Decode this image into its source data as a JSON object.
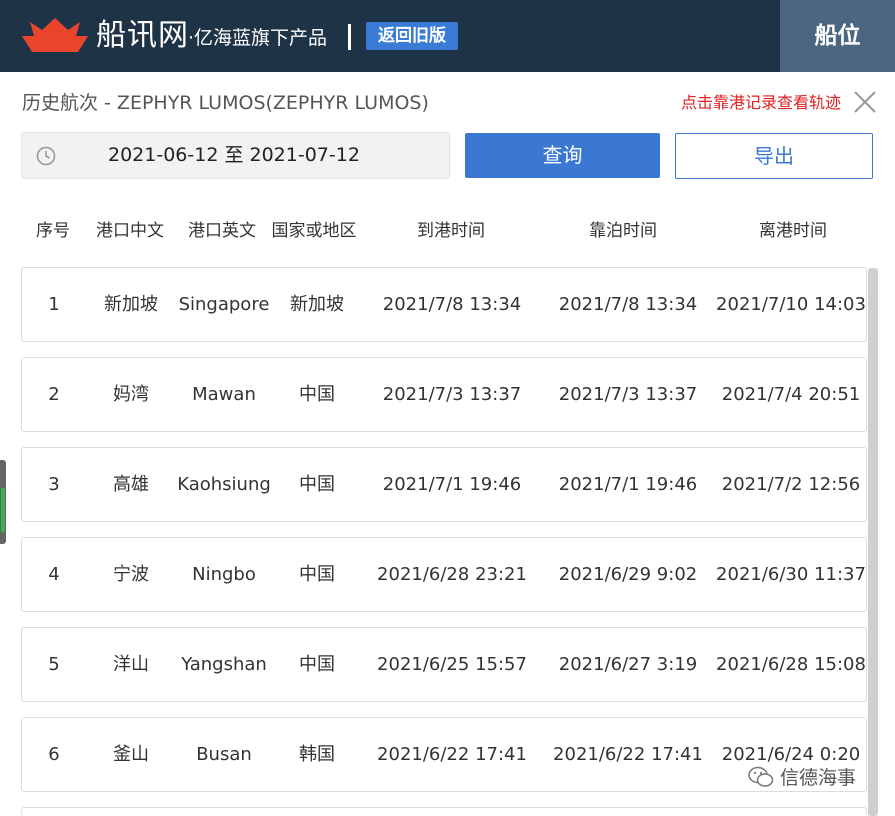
{
  "header": {
    "brand": "船讯网",
    "brand_sub": "·亿海蓝旗下产品",
    "old_version_label": "返回旧版",
    "berth_tab_label": "船位",
    "logo_icon": "boat-logo-icon"
  },
  "panel": {
    "title": "历史航次 - ZEPHYR LUMOS(ZEPHYR LUMOS)",
    "track_link": "点击靠港记录查看轨迹",
    "close_icon": "close-icon"
  },
  "filter": {
    "date_range": "2021-06-12 至 2021-07-12",
    "query_label": "查询",
    "export_label": "导出",
    "clock_icon": "clock-icon"
  },
  "table": {
    "headers": [
      "序号",
      "港口中文",
      "港口英文",
      "国家或地区",
      "到港时间",
      "靠泊时间",
      "离港时间"
    ],
    "rows": [
      {
        "no": "1",
        "port_cn": "新加坡",
        "port_en": "Singapore",
        "country": "新加坡",
        "arrive": "2021/7/8 13:34",
        "berth": "2021/7/8 13:34",
        "depart": "2021/7/10 14:03"
      },
      {
        "no": "2",
        "port_cn": "妈湾",
        "port_en": "Mawan",
        "country": "中国",
        "arrive": "2021/7/3 13:37",
        "berth": "2021/7/3 13:37",
        "depart": "2021/7/4 20:51"
      },
      {
        "no": "3",
        "port_cn": "高雄",
        "port_en": "Kaohsiung",
        "country": "中国",
        "arrive": "2021/7/1 19:46",
        "berth": "2021/7/1 19:46",
        "depart": "2021/7/2 12:56"
      },
      {
        "no": "4",
        "port_cn": "宁波",
        "port_en": "Ningbo",
        "country": "中国",
        "arrive": "2021/6/28 23:21",
        "berth": "2021/6/29 9:02",
        "depart": "2021/6/30 11:37"
      },
      {
        "no": "5",
        "port_cn": "洋山",
        "port_en": "Yangshan",
        "country": "中国",
        "arrive": "2021/6/25 15:57",
        "berth": "2021/6/27 3:19",
        "depart": "2021/6/28 15:08"
      },
      {
        "no": "6",
        "port_cn": "釜山",
        "port_en": "Busan",
        "country": "韩国",
        "arrive": "2021/6/22 17:41",
        "berth": "2021/6/22 17:41",
        "depart": "2021/6/24 0:20"
      }
    ]
  },
  "watermark": {
    "text": "信德海事",
    "icon": "wechat-icon"
  },
  "colors": {
    "header_bg": "#1f3347",
    "accent": "#3a78d4",
    "link_red": "#e02020",
    "logo_red": "#e8452c"
  }
}
